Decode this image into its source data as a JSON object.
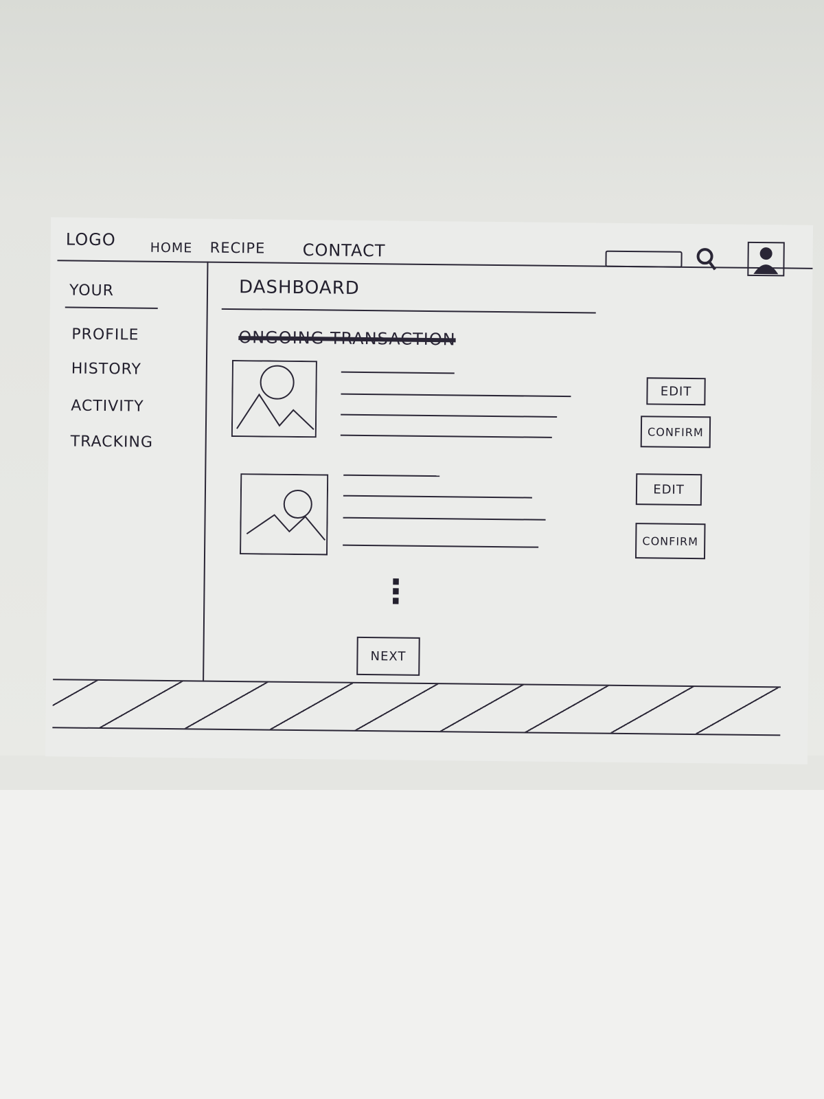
{
  "header": {
    "logo": "LOGO",
    "nav": [
      "HOME",
      "RECIPE",
      "CONTACT"
    ],
    "search_placeholder": "",
    "icons": [
      "search-icon",
      "user-avatar-icon"
    ]
  },
  "sidebar": {
    "title": "YOUR",
    "items": [
      "PROFILE",
      "HISTORY",
      "ACTIVITY",
      "TRACKING"
    ]
  },
  "main": {
    "title": "DASHBOARD",
    "section_heading": "ONGOING TRANSACTION",
    "items": [
      {
        "image": "image-placeholder-icon",
        "edit": "EDIT",
        "confirm": "CONFIRM"
      },
      {
        "image": "image-placeholder-icon",
        "edit": "EDIT",
        "confirm": "CONFIRM"
      }
    ],
    "more_indicator": "⋮",
    "next_label": "NEXT"
  },
  "colors": {
    "ink": "#2a2636",
    "paper": "#ebecea"
  }
}
